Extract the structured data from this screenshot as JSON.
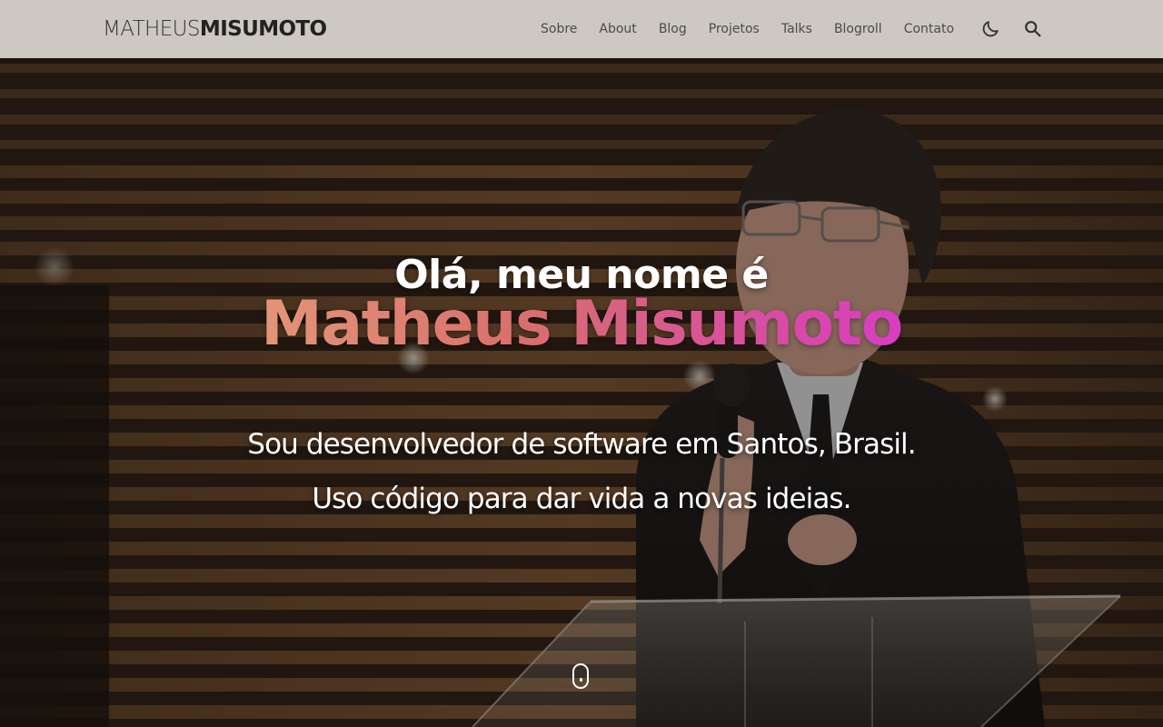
{
  "header": {
    "logo": {
      "first": "MATHEUS",
      "last": "MISUMOTO"
    },
    "nav": [
      {
        "label": "Sobre"
      },
      {
        "label": "About"
      },
      {
        "label": "Blog"
      },
      {
        "label": "Projetos"
      },
      {
        "label": "Talks"
      },
      {
        "label": "Blogroll"
      },
      {
        "label": "Contato"
      }
    ],
    "icons": {
      "theme_toggle": "moon-icon",
      "search": "search-icon"
    }
  },
  "hero": {
    "greeting": "Olá, meu nome é",
    "name": "Matheus Misumoto",
    "tagline_line1": "Sou desenvolvedor de software em Santos, Brasil.",
    "tagline_line2": "Uso código para dar vida a novas ideias.",
    "scroll_icon": "mouse-scroll-icon"
  },
  "colors": {
    "header_bg": "#cdc8c2",
    "name_gradient_start": "#e39578",
    "name_gradient_end": "#d93cc3",
    "text": "#ffffff"
  }
}
